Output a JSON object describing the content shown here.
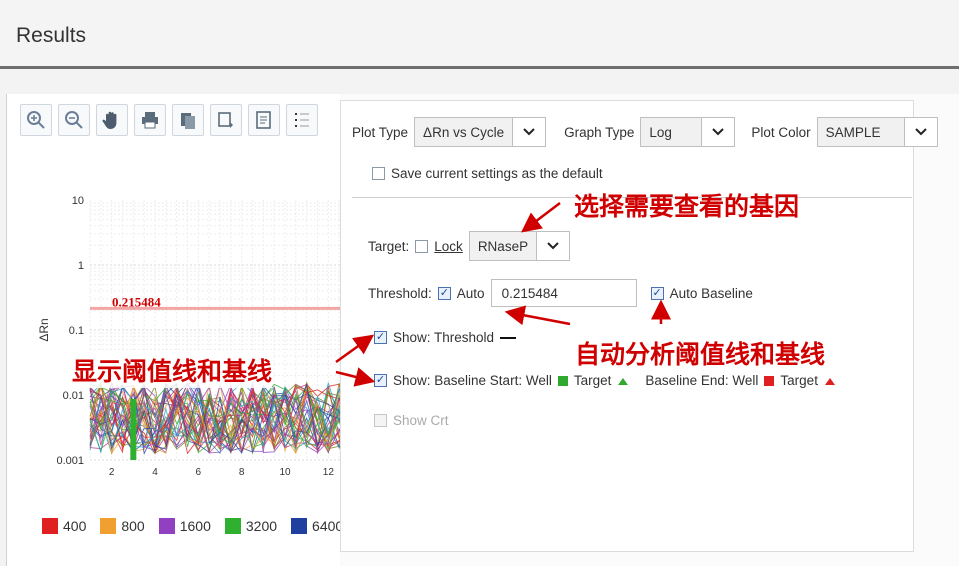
{
  "header": {
    "title": "Results"
  },
  "toolbar": {
    "buttons": [
      "zoom-in-icon",
      "zoom-out-icon",
      "pan-hand-icon",
      "print-icon",
      "copy-icon",
      "export-icon",
      "report-icon",
      "legend-icon"
    ]
  },
  "plot_settings": {
    "plot_type_label": "Plot Type",
    "plot_type_value": "ΔRn vs Cycle",
    "graph_type_label": "Graph Type",
    "graph_type_value": "Log",
    "plot_color_label": "Plot Color",
    "plot_color_value": "SAMPLE",
    "save_default_label": "Save current settings as the default",
    "target_label": "Target:",
    "lock_label": "Lock",
    "target_value": "RNaseP",
    "threshold_label": "Threshold:",
    "auto_label": "Auto",
    "threshold_value": "0.215484",
    "auto_baseline_label": "Auto Baseline",
    "show_threshold_label": "Show: Threshold",
    "show_baseline_label": "Show: Baseline Start: Well",
    "target_word": "Target",
    "baseline_end_label": "Baseline End: Well",
    "show_crt_label": "Show Crt"
  },
  "annotations": {
    "select_gene": "选择需要查看的基因",
    "auto_analyze": "自动分析阈值线和基线",
    "show_lines": "显示阈值线和基线"
  },
  "colors": {
    "annotation": "#d00000",
    "threshold_line": "#e88"
  },
  "chart_data": {
    "type": "line",
    "title": "",
    "xlabel": "",
    "ylabel": "ΔRn",
    "yscale": "log",
    "yticks": [
      "10",
      "1",
      "0.1",
      "0.01",
      "0.001"
    ],
    "xticks": [
      "2",
      "4",
      "6",
      "8",
      "10",
      "12"
    ],
    "xlim": [
      1,
      13
    ],
    "ylim": [
      0.001,
      10
    ],
    "threshold": 0.215484,
    "threshold_label": "0.215484",
    "legend": [
      {
        "name": "400",
        "color": "#e02020"
      },
      {
        "name": "800",
        "color": "#f0a030"
      },
      {
        "name": "1600",
        "color": "#9040c0"
      },
      {
        "name": "3200",
        "color": "#30b030"
      },
      {
        "name": "6400",
        "color": "#2040a0"
      }
    ]
  }
}
